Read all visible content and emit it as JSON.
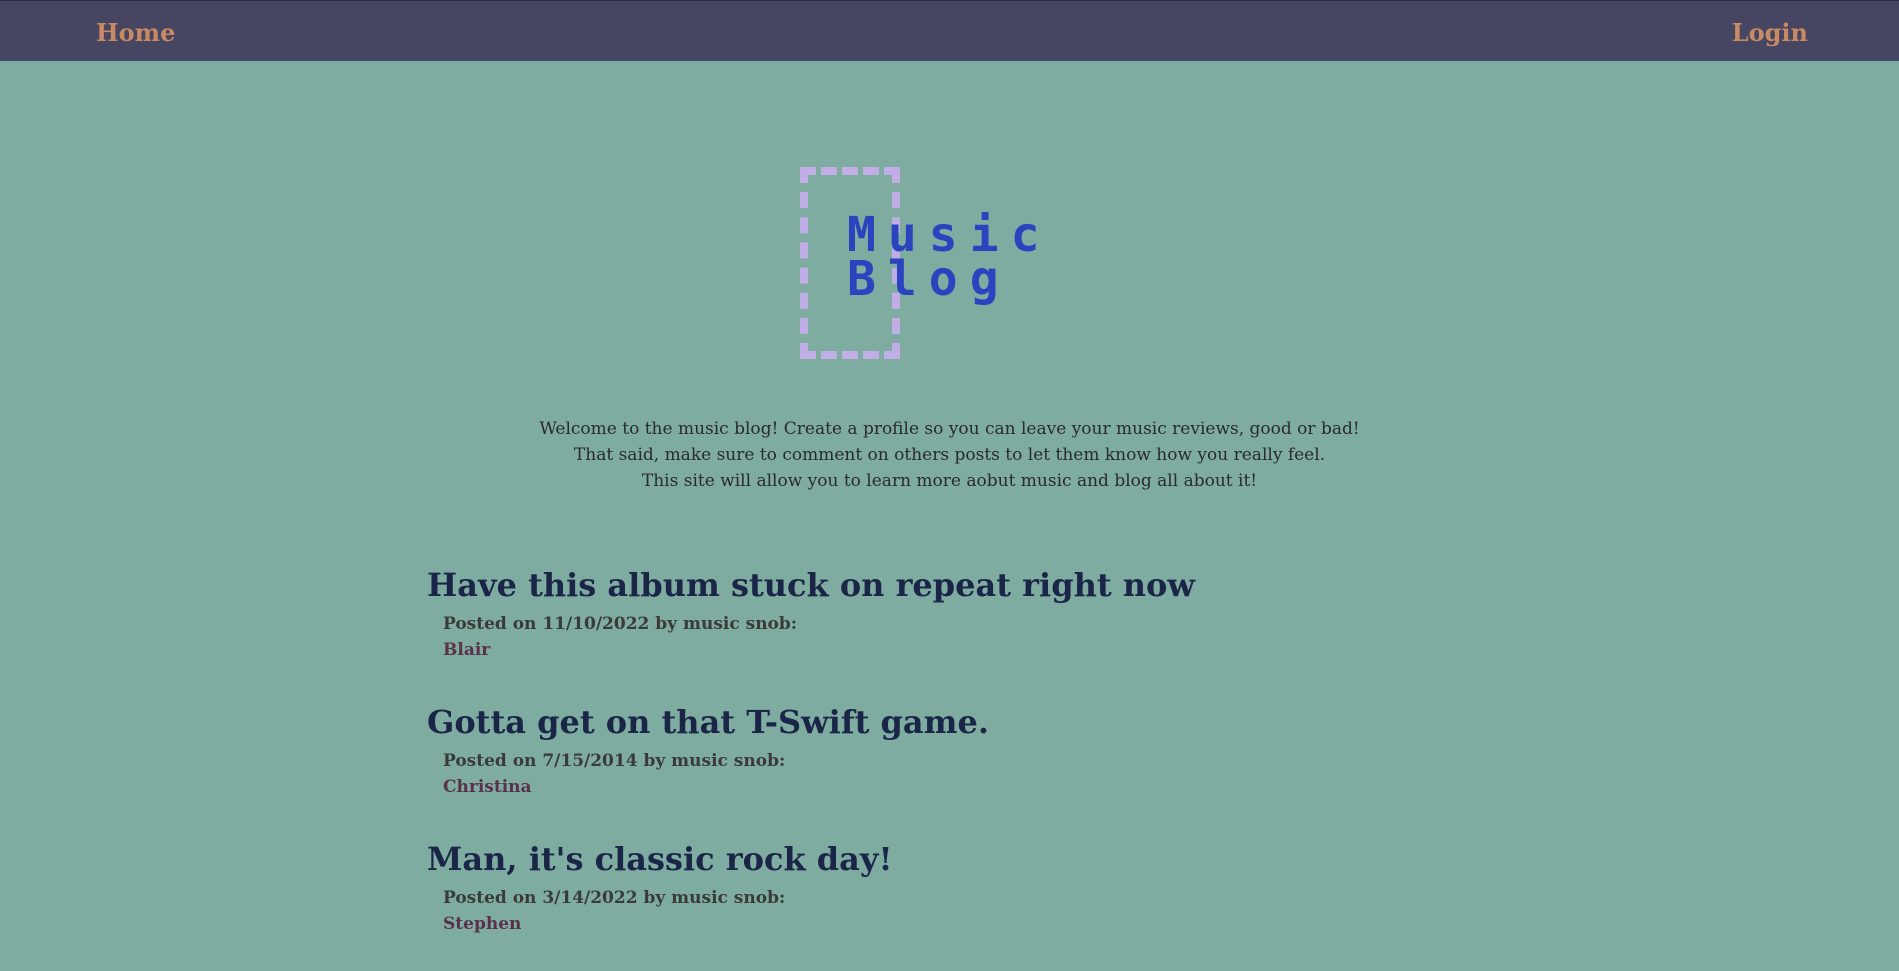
{
  "nav": {
    "home_label": "Home",
    "login_label": "Login"
  },
  "logo": {
    "line1": "Music",
    "line2": "Blog"
  },
  "intro": {
    "lines": [
      "Welcome to the music blog! Create a profile so you can leave your music reviews, good or bad!",
      "That said, make sure to comment on others posts to let them know how you really feel.",
      "This site will allow you to learn more aobut music and blog all about it!"
    ]
  },
  "posts": [
    {
      "title": "Have this album stuck on repeat right now",
      "meta": "Posted on 11/10/2022 by music snob:",
      "author": "Blair"
    },
    {
      "title": "Gotta get on that T-Swift game.",
      "meta": "Posted on 7/15/2014 by music snob:",
      "author": "Christina"
    },
    {
      "title": "Man, it's classic rock day!",
      "meta": "Posted on 3/14/2022 by music snob:",
      "author": "Stephen"
    }
  ],
  "colors": {
    "background": "#7eaca1",
    "navbar": "#464663",
    "nav_link": "#c88a62",
    "logo_text": "#2a43be",
    "logo_border": "#c1aee6",
    "post_title": "#1b2547",
    "post_author": "#5a3148"
  }
}
